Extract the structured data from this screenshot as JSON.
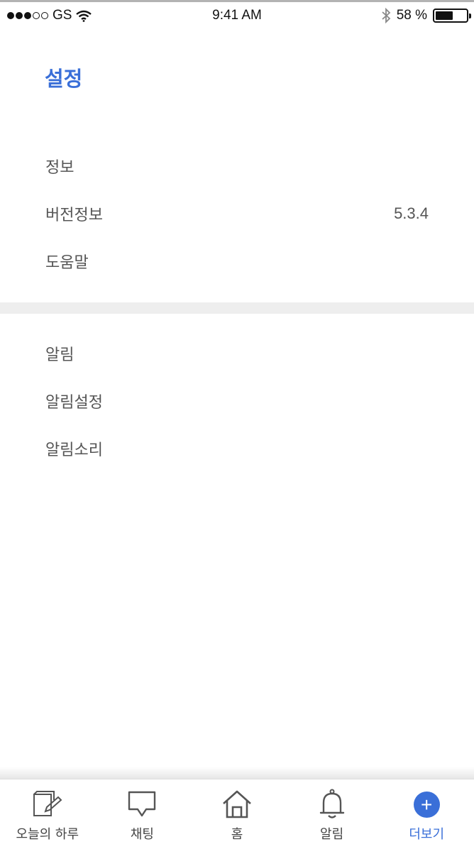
{
  "status_bar": {
    "carrier": "GS",
    "time": "9:41 AM",
    "battery": "58 %",
    "battery_level": 0.58
  },
  "header": {
    "title": "설정"
  },
  "info_section": {
    "items": [
      {
        "label": "정보",
        "value": ""
      },
      {
        "label": "버전정보",
        "value": "5.3.4"
      },
      {
        "label": "도움말",
        "value": ""
      }
    ]
  },
  "notification_section": {
    "items": [
      {
        "label": "알림"
      },
      {
        "label": "알림설정"
      },
      {
        "label": "알림소리"
      }
    ]
  },
  "tab_bar": {
    "tabs": [
      {
        "label": "오늘의 하루",
        "icon": "diary-edit-icon"
      },
      {
        "label": "채팅",
        "icon": "chat-bubble-icon"
      },
      {
        "label": "홈",
        "icon": "home-icon"
      },
      {
        "label": "알림",
        "icon": "bell-icon"
      },
      {
        "label": "더보기",
        "icon": "plus-circle-icon",
        "active": true
      }
    ],
    "more_symbol": "+"
  },
  "colors": {
    "accent": "#3a6fd8",
    "text": "#555555",
    "divider": "#eeeeee"
  }
}
